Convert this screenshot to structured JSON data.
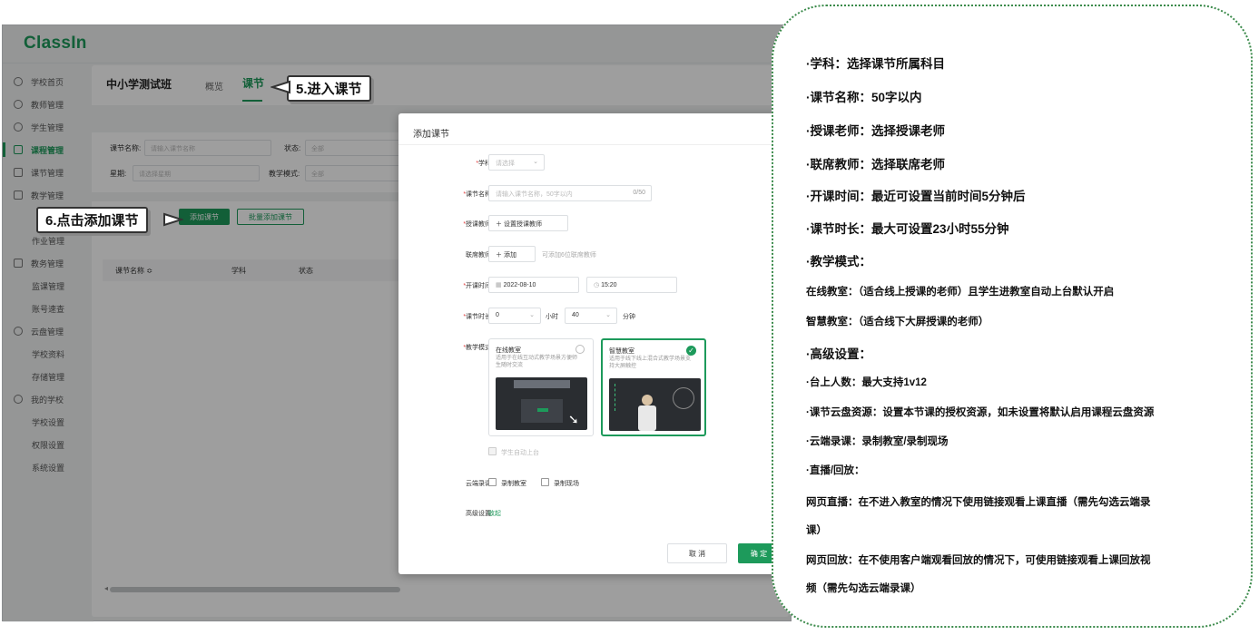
{
  "app": {
    "logo": "ClassIn",
    "sidebar": [
      {
        "label": "学校首页",
        "icon": "home-icon"
      },
      {
        "label": "教师管理",
        "icon": "teacher-icon"
      },
      {
        "label": "学生管理",
        "icon": "student-icon"
      },
      {
        "label": "课程管理",
        "icon": "course-icon",
        "active": true
      },
      {
        "label": "课节管理",
        "icon": "lesson-icon"
      },
      {
        "label": "教学管理",
        "icon": "teaching-icon"
      },
      {
        "label": "作业管理",
        "sub": true
      },
      {
        "label": "教务管理",
        "icon": "academic-icon"
      },
      {
        "label": "监课管理",
        "sub": true
      },
      {
        "label": "账号速查",
        "sub": true
      },
      {
        "label": "云盘管理",
        "icon": "cloud-icon"
      },
      {
        "label": "学校资料",
        "sub": true
      },
      {
        "label": "存储管理",
        "sub": true
      },
      {
        "label": "我的学校",
        "icon": "school-icon"
      },
      {
        "label": "学校设置",
        "sub": true
      },
      {
        "label": "权限设置",
        "sub": true
      },
      {
        "label": "系统设置",
        "sub": true
      }
    ],
    "header": {
      "class_title": "中小学测试班",
      "tab_overview": "概览",
      "tab_lessons": "课节"
    },
    "filters": {
      "lesson_name_label": "课节名称:",
      "lesson_name_placeholder": "请输入课节名称",
      "status_label": "状态:",
      "status_value": "全部",
      "week_label": "星期:",
      "week_placeholder": "请选择星期",
      "mode_label": "教学模式:",
      "mode_value": "全部"
    },
    "actions": {
      "add_lesson": "添加课节",
      "batch_add": "批量添加课节"
    },
    "table_headers": [
      "课节名称 ≎",
      "学科",
      "状态"
    ]
  },
  "dialog": {
    "title": "添加课节",
    "subject": {
      "label": "学科:",
      "placeholder": "请选择"
    },
    "lesson_name": {
      "label": "课节名称:",
      "placeholder": "请输入课节名称，50字以内",
      "counter": "0/50"
    },
    "teacher": {
      "label": "授课教师:",
      "button": "＋  设置授课教师"
    },
    "co_teacher": {
      "label": "联席教师:",
      "button": "＋  添加",
      "hint": "可添加6位联席教师"
    },
    "start_time": {
      "label": "开课时间:",
      "date": "2022-08-10",
      "time": "15:20"
    },
    "duration": {
      "label": "课节时长:",
      "hours": "0",
      "hours_unit": "小时",
      "minutes": "40",
      "minutes_unit": "分钟"
    },
    "teaching_mode": {
      "label": "教学模式:",
      "online": {
        "title": "在线教室",
        "desc": "适用于在线互动式教学场景方便师生随时交流"
      },
      "smart": {
        "title": "智慧教室",
        "desc": "适用于线下线上混合式教学场景支持大屏触控"
      },
      "auto_stage": "学生自动上台"
    },
    "cloud_record": {
      "label": "云端录课:",
      "opt1": "录制教室",
      "opt2": "录制现场"
    },
    "advanced": {
      "label": "高级设置:",
      "link": "收起"
    },
    "cancel": "取 消",
    "confirm": "确 定"
  },
  "callouts": {
    "step5": "5.进入课节",
    "step6": "6.点击添加课节"
  },
  "info_panel": [
    "·学科：选择课节所属科目",
    "·课节名称：50字以内",
    "·授课老师：选择授课老师",
    "·联席教师：选择联席老师",
    "·开课时间：最近可设置当前时间5分钟后",
    "·课节时长：最大可设置23小时55分钟",
    "·教学模式：",
    " 在线教室：（适合线上授课的老师）且学生进教室自动上台默认开启",
    " 智慧教室：（适合线下大屏授课的老师）",
    "·高级设置：",
    "·台上人数：最大支持1v12",
    "·课节云盘资源：设置本节课的授权资源，如未设置将默认启用课程云盘资源",
    "·云端录课：录制教室/录制现场",
    "·直播/回放：",
    " 网页直播：在不进入教室的情况下使用链接观看上课直播（需先勾选云端录",
    "课）",
    " 网页回放：在不使用客户端观看回放的情况下，可使用链接观看上课回放视",
    "频（需先勾选云端录课）"
  ],
  "colors": {
    "brand": "#1d9a5b",
    "required": "#e23b3b",
    "panel_border": "#3a8a4a"
  }
}
